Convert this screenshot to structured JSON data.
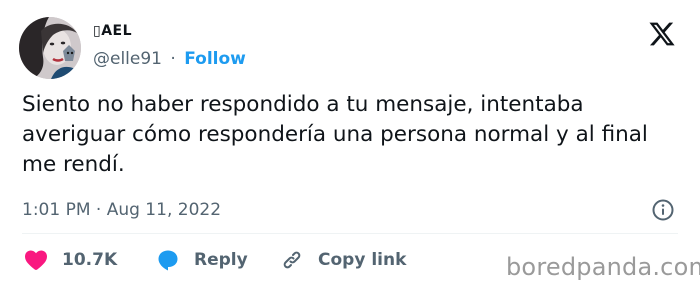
{
  "user": {
    "display_name": "▯AEL",
    "handle": "@elle91",
    "separator": "·",
    "follow_label": "Follow"
  },
  "tweet": {
    "text": "Siento no haber respondido a tu mensaje, intentaba averiguar cómo respondería una persona normal y al final me rendí.",
    "timestamp": "1:01 PM · Aug 11, 2022"
  },
  "actions": {
    "like_count": "10.7K",
    "reply_label": "Reply",
    "copy_link_label": "Copy link"
  },
  "watermark": "boredpanda.com",
  "colors": {
    "accent": "#1d9bf0",
    "like": "#f91880",
    "text": "#0f1419",
    "muted": "#536471"
  },
  "icons": {
    "logo": "x-logo-icon",
    "info": "info-icon",
    "like": "heart-icon",
    "reply": "reply-bubble-icon",
    "copy": "link-icon"
  }
}
